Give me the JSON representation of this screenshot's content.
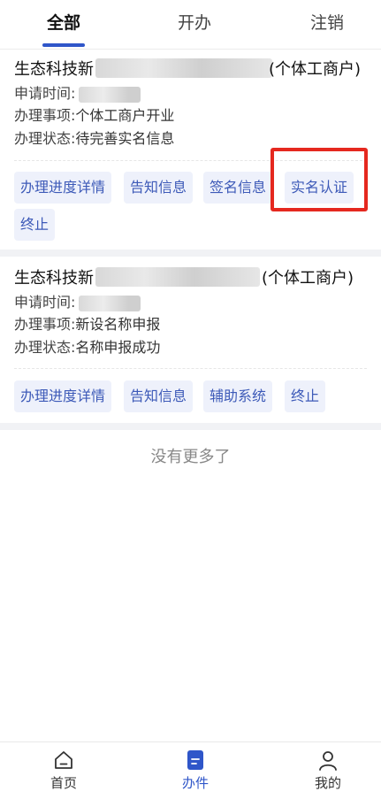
{
  "tabs": [
    {
      "label": "全部",
      "active": true
    },
    {
      "label": "开办",
      "active": false
    },
    {
      "label": "注销",
      "active": false
    }
  ],
  "cards": [
    {
      "name_prefix": "生态科技新",
      "name_suffix": "(个体工商户)",
      "apply_time_label": "申请时间:",
      "matter_label": "办理事项:",
      "matter_value": "个体工商户开业",
      "status_label": "办理状态:",
      "status_value": "待完善实名信息",
      "buttons": [
        "办理进度详情",
        "告知信息",
        "签名信息",
        "实名认证",
        "终止"
      ]
    },
    {
      "name_prefix": "生态科技新",
      "name_suffix": "(个体工商户)",
      "apply_time_label": "申请时间:",
      "matter_label": "办理事项:",
      "matter_value": "新设名称申报",
      "status_label": "办理状态:",
      "status_value": "名称申报成功",
      "buttons": [
        "办理进度详情",
        "告知信息",
        "辅助系统",
        "终止"
      ]
    }
  ],
  "footer_text": "没有更多了",
  "bottom_nav": [
    {
      "label": "首页",
      "icon": "home-icon",
      "active": false
    },
    {
      "label": "办件",
      "icon": "document-icon",
      "active": true
    },
    {
      "label": "我的",
      "icon": "user-icon",
      "active": false
    }
  ],
  "colors": {
    "accent": "#2f56c9",
    "button_bg": "#eef1fb",
    "button_text": "#3d5ab8",
    "highlight": "#e5281f"
  }
}
